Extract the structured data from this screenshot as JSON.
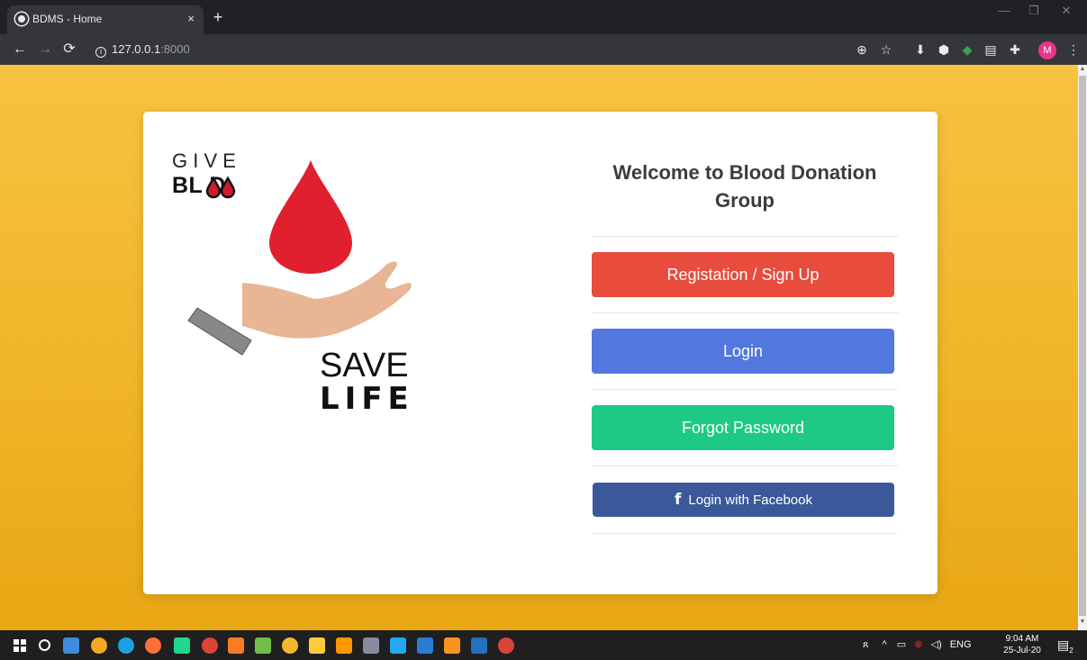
{
  "browser": {
    "tab_title": "BDMS - Home",
    "tab_close": "×",
    "new_tab": "+",
    "url_host": "127.0.0.1",
    "url_port": ":8000",
    "profile_initial": "M",
    "window_controls": [
      "—",
      "❐",
      "✕"
    ]
  },
  "page": {
    "welcome_title": "Welcome to Blood Donation Group",
    "logo": {
      "give": "G I V E",
      "blood": "BL  D",
      "save": "SAVE",
      "life": "LIFE"
    },
    "buttons": {
      "register": "Registation / Sign Up",
      "login": "Login",
      "forgot": "Forgot Password",
      "facebook": "Login with Facebook",
      "facebook_icon": "f"
    },
    "colors": {
      "register": "#e74c3c",
      "login": "#5277de",
      "forgot": "#1ec986",
      "facebook": "#3b5998",
      "background": "#f0b528"
    }
  },
  "taskbar": {
    "language": "ENG",
    "time": "9:04 AM",
    "date": "25-Jul-20",
    "notification_count": "2"
  }
}
